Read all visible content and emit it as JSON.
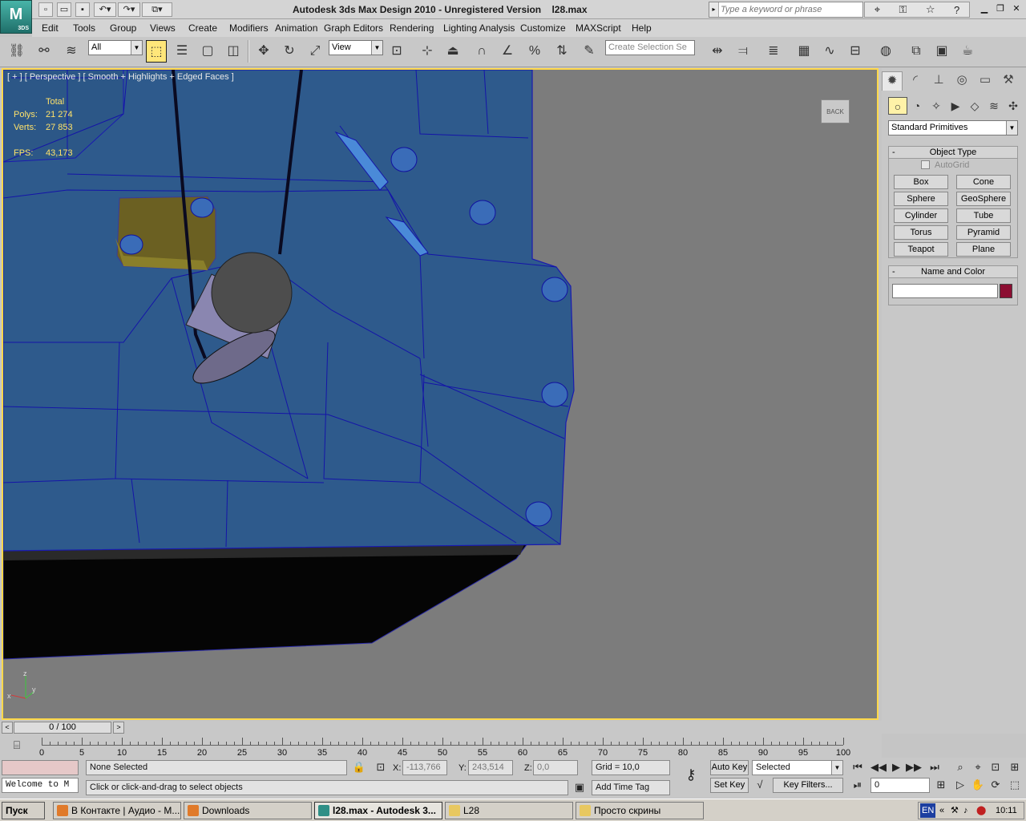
{
  "app": {
    "title": "Autodesk 3ds Max Design 2010",
    "subtitle": "- Unregistered Version",
    "file": "l28.max",
    "logo_text": "M",
    "logo_sub": "3DS"
  },
  "search": {
    "placeholder": "Type a keyword or phrase"
  },
  "menus": [
    "Edit",
    "Tools",
    "Group",
    "Views",
    "Create",
    "Modifiers",
    "Animation",
    "Graph Editors",
    "Rendering",
    "Lighting Analysis",
    "Customize",
    "MAXScript",
    "Help"
  ],
  "toolbar": {
    "selection_filter": "All",
    "ref_coord": "View",
    "named_selection": "Create Selection Se"
  },
  "viewport": {
    "label": "[ + ] [ Perspective ] [ Smooth + Highlights + Edged Faces ]",
    "stats_header": "Total",
    "polys_label": "Polys:",
    "polys_value": "21 274",
    "verts_label": "Verts:",
    "verts_value": "27 853",
    "fps_label": "FPS:",
    "fps_value": "43,173",
    "viewcube": "BACK",
    "axis_z": "z",
    "axis_y": "y",
    "axis_x": "x"
  },
  "command_panel": {
    "category": "Standard Primitives",
    "object_type_title": "Object Type",
    "autogrid": "AutoGrid",
    "primitives": [
      "Box",
      "Cone",
      "Sphere",
      "GeoSphere",
      "Cylinder",
      "Tube",
      "Torus",
      "Pyramid",
      "Teapot",
      "Plane"
    ],
    "name_color_title": "Name and Color",
    "object_color": "#8c0e32"
  },
  "timeline": {
    "frame_display": "0 / 100",
    "ticks": [
      "0",
      "5",
      "10",
      "15",
      "20",
      "25",
      "30",
      "35",
      "40",
      "45",
      "50",
      "55",
      "60",
      "65",
      "70",
      "75",
      "80",
      "85",
      "90",
      "95",
      "100"
    ]
  },
  "status": {
    "selection": "None Selected",
    "prompt": "Click or click-and-drag to select objects",
    "listener": "Welcome to M",
    "x_label": "X:",
    "x_value": "-113,766",
    "y_label": "Y:",
    "y_value": "243,514",
    "z_label": "Z:",
    "z_value": "0,0",
    "grid": "Grid = 10,0",
    "add_time_tag": "Add Time Tag",
    "auto_key": "Auto Key",
    "set_key": "Set Key",
    "key_mode": "Selected",
    "key_filters": "Key Filters...",
    "current_frame": "0"
  },
  "taskbar": {
    "start": "Пуск",
    "tasks": [
      "В Контакте | Аудио - М...",
      "Downloads",
      "l28.max - Autodesk 3...",
      "L28",
      "Просто скрины"
    ],
    "lang": "EN",
    "time": "10:11"
  }
}
